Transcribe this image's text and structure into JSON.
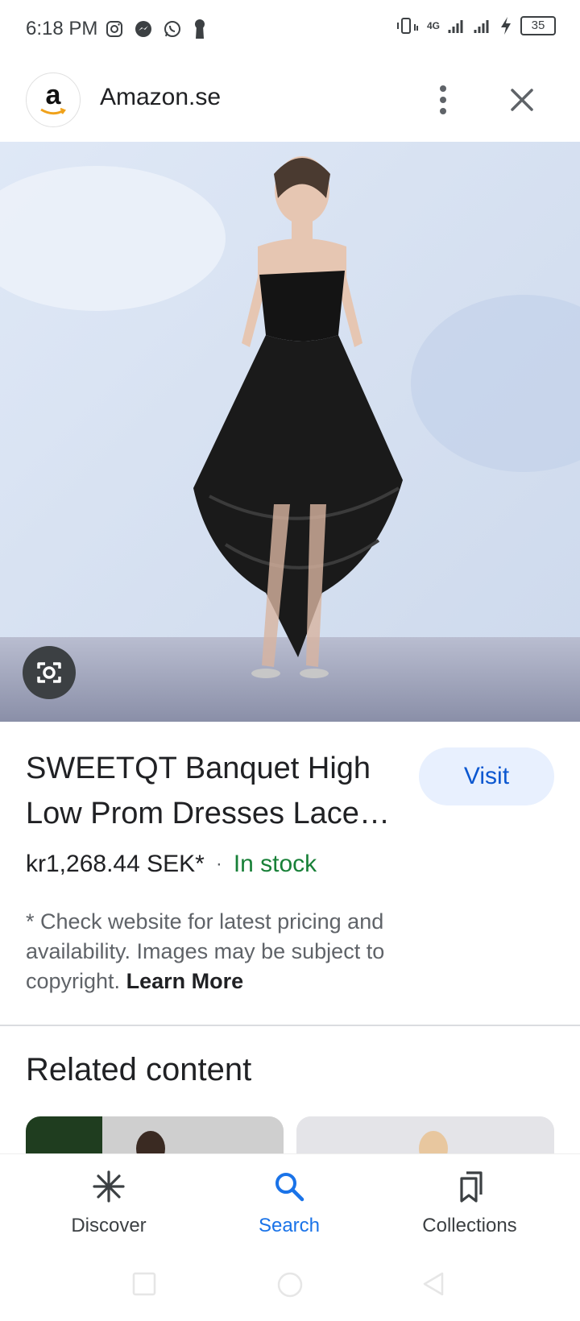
{
  "status": {
    "time": "6:18 PM",
    "battery": "35",
    "network": "4G"
  },
  "header": {
    "site_name": "Amazon.se",
    "logo_letter": "a"
  },
  "product": {
    "title": "SWEETQT Banquet High Low Prom Dresses Lace Strapless",
    "visit_label": "Visit",
    "price": "kr1,268.44 SEK*",
    "separator": "·",
    "stock": "In stock",
    "note": "* Check website for latest pricing and availability. Images may be subject to copyright.",
    "learn_more": "Learn More"
  },
  "related": {
    "title": "Related content"
  },
  "bottom_nav": {
    "items": [
      {
        "label": "Discover",
        "icon": "discover-asterisk-icon"
      },
      {
        "label": "Search",
        "icon": "search-icon",
        "active": true
      },
      {
        "label": "Collections",
        "icon": "collections-bookmark-icon"
      }
    ]
  },
  "colors": {
    "accent": "#1a73e8",
    "visit_bg": "#e8f0fe",
    "in_stock": "#188038"
  }
}
